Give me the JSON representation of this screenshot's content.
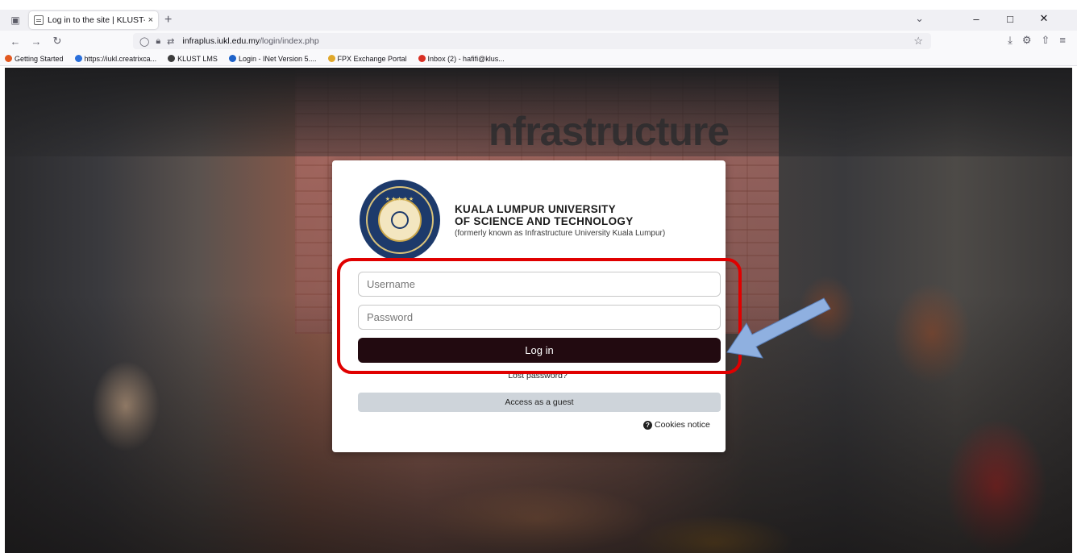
{
  "browser": {
    "tab_title": "Log in to the site | KLUST-Infra ",
    "tab_close": "×",
    "new_tab": "+",
    "url_host": "infraplus.iukl.edu.my",
    "url_path": "/login/index.php",
    "icons": [
      "tab-list-icon",
      "back-icon",
      "forward-icon",
      "reload-icon",
      "shield-icon",
      "lock-icon",
      "permissions-icon",
      "star-icon",
      "download-icon",
      "extensions-icon",
      "share-icon",
      "menu-icon"
    ]
  },
  "bookmarks": [
    {
      "label": "Getting Started",
      "color": "#e25920"
    },
    {
      "label": "https://iukl.creatrixca...",
      "color": "#2a6fdb"
    },
    {
      "label": "KLUST LMS",
      "color": "#3d3d3d"
    },
    {
      "label": "Login - INet Version 5....",
      "color": "#1e62c9"
    },
    {
      "label": "FPX Exchange Portal",
      "color": "#e0a82b"
    },
    {
      "label": "Inbox (2) - hafifi@klus...",
      "color": "#d93025"
    }
  ],
  "background": {
    "wall_text": "nfrastructure"
  },
  "login": {
    "org_line1": "KUALA LUMPUR UNIVERSITY",
    "org_line2": "OF SCIENCE AND TECHNOLOGY",
    "org_line3": "(formerly known as Infrastructure University Kuala Lumpur)",
    "seal_text": "KUALA LUMPUR UNIVERSITY OF SCIENCE AND TECHNOLOGY KLUST",
    "username_placeholder": "Username",
    "password_placeholder": "Password",
    "login_label": "Log in",
    "lost_password": "Lost password?",
    "guest_label": "Access as a guest",
    "cookies_label": "Cookies notice"
  },
  "annotation": {
    "highlight_color": "#e00000",
    "arrow_color": "#8fb0e0"
  }
}
